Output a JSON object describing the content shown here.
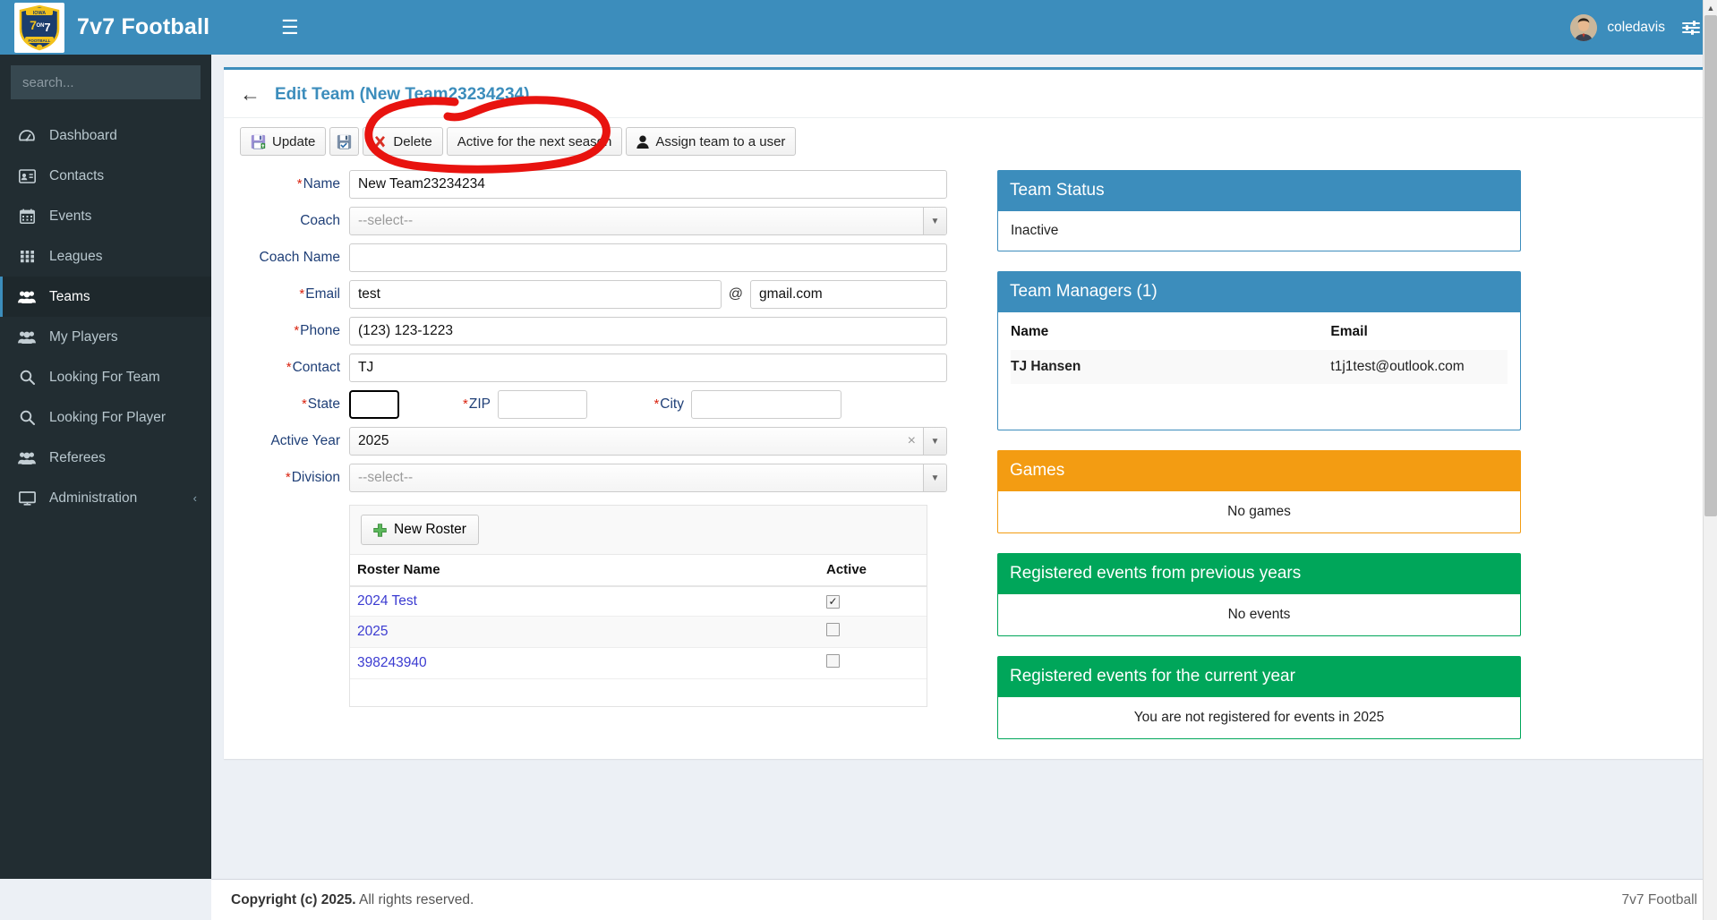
{
  "header": {
    "brand": "7v7 Football",
    "logo_alt": "iowa-7on7-football-shield-logo",
    "menu_icon": "hamburger-icon",
    "user_name": "coledavis",
    "settings_icon": "sliders-icon"
  },
  "sidebar": {
    "search_placeholder": "search...",
    "search_value": "",
    "search_icon": "search-icon",
    "items": [
      {
        "label": "Dashboard",
        "icon": "dashboard-icon",
        "active": false
      },
      {
        "label": "Contacts",
        "icon": "contact-card-icon",
        "active": false
      },
      {
        "label": "Events",
        "icon": "calendar-icon",
        "active": false
      },
      {
        "label": "Leagues",
        "icon": "grid-icon",
        "active": false
      },
      {
        "label": "Teams",
        "icon": "users-icon",
        "active": true
      },
      {
        "label": "My Players",
        "icon": "users-icon",
        "active": false
      },
      {
        "label": "Looking For Team",
        "icon": "search-icon",
        "active": false
      },
      {
        "label": "Looking For Player",
        "icon": "search-icon",
        "active": false
      },
      {
        "label": "Referees",
        "icon": "users-icon",
        "active": false
      },
      {
        "label": "Administration",
        "icon": "monitor-icon",
        "active": false,
        "caret": "‹"
      }
    ]
  },
  "page": {
    "back_icon": "arrow-left-icon",
    "title": "Edit Team (New Team23234234)",
    "toolbar": {
      "update_label": "Update",
      "update_icon": "save-icon",
      "save_icon_only": "save-check-icon",
      "delete_label": "Delete",
      "delete_icon": "red-x-icon",
      "active_next_season_label": "Active for the next season",
      "assign_label": "Assign team to a user",
      "assign_icon": "person-icon"
    }
  },
  "form": {
    "name": {
      "label": "Name",
      "required": true,
      "value": "New Team23234234"
    },
    "coach": {
      "label": "Coach",
      "required": false,
      "value": "--select--",
      "type": "select"
    },
    "coach_name": {
      "label": "Coach Name",
      "required": false,
      "value": ""
    },
    "email": {
      "label": "Email",
      "required": true,
      "value": "test",
      "at": "@",
      "domain": "gmail.com"
    },
    "phone": {
      "label": "Phone",
      "required": true,
      "value": "(123) 123-1223"
    },
    "contact": {
      "label": "Contact",
      "required": true,
      "value": "TJ"
    },
    "state": {
      "label": "State",
      "required": true,
      "value": "",
      "focused": true
    },
    "zip": {
      "label": "ZIP",
      "required": true,
      "value": ""
    },
    "city": {
      "label": "City",
      "required": true,
      "value": ""
    },
    "active_year": {
      "label": "Active Year",
      "required": false,
      "value": "2025",
      "type": "select",
      "clear_icon": "×"
    },
    "division": {
      "label": "Division",
      "required": true,
      "value": "--select--",
      "type": "select"
    }
  },
  "roster": {
    "new_button": "New Roster",
    "new_button_icon": "plus-icon",
    "columns": [
      "Roster Name",
      "Active"
    ],
    "rows": [
      {
        "name": "2024 Test",
        "active": true
      },
      {
        "name": "2025",
        "active": false
      },
      {
        "name": "398243940",
        "active": false
      }
    ]
  },
  "panels": {
    "team_status": {
      "title": "Team Status",
      "body": "Inactive",
      "color": "#3c8dbc"
    },
    "team_managers": {
      "title": "Team Managers (1)",
      "color": "#3c8dbc",
      "columns": [
        "Name",
        "Email"
      ],
      "rows": [
        {
          "name": "TJ Hansen",
          "email": "t1j1test@outlook.com"
        }
      ]
    },
    "games": {
      "title": "Games",
      "body": "No games",
      "color": "#f39c12"
    },
    "events_prev": {
      "title": "Registered events from previous years",
      "body": "No events",
      "color": "#00a65a"
    },
    "events_curr": {
      "title": "Registered events for the current year",
      "body": "You are not registered for events in 2025",
      "color": "#00a65a"
    }
  },
  "footer": {
    "copyright": "Copyright (c) 2025.",
    "rights": "All rights reserved.",
    "right_text": "7v7 Football"
  },
  "annotation": {
    "shape": "red-circle-highlight",
    "color": "#e8130f"
  }
}
